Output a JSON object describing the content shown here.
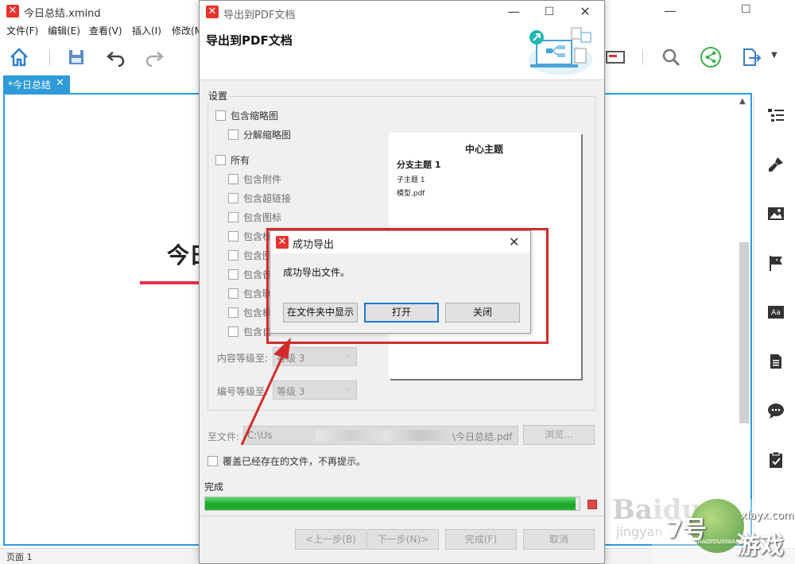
{
  "app": {
    "window_title": "今日总结.xmind",
    "menu": [
      "文件(F)",
      "编辑(E)",
      "查看(V)",
      "插入(I)",
      "修改(M"
    ],
    "doc_tab": "*今日总结",
    "canvas_title_fragment": "今日",
    "status_text": "页面 1"
  },
  "dialog": {
    "window_title": "导出到PDF文档",
    "heading": "导出到PDF文档",
    "settings_group_label": "设置",
    "options": {
      "include_thumbnail": "包含缩略图",
      "split_thumbnail": "分解缩略图",
      "all": "所有",
      "include_attachments": "包含附件",
      "include_hyperlinks": "包含超链接",
      "include_icons": "包含图标",
      "include_labels": "包含标",
      "include_images": "包含图",
      "include_notes": "包含备",
      "include_links": "包含联",
      "include_summary": "包含概",
      "include_custom": "包含自"
    },
    "content_level_label": "内容等级至:",
    "content_level_value": "等级 3",
    "number_level_label": "编号等级至:",
    "number_level_value": "等级 3",
    "preview": {
      "central_topic": "中心主题",
      "branch_topic": "分支主题 1",
      "subtopic": "子主题 1",
      "attachment": "模型.pdf"
    },
    "file_label": "至文件:",
    "file_path_prefix": "C:\\Us",
    "file_path_suffix": "\\今日总结.pdf",
    "browse_button": "浏览...",
    "overwrite_checkbox": "覆盖已经存在的文件，不再提示。",
    "progress_label": "完成",
    "progress_fraction": 0.99,
    "buttons": {
      "back": "<上一步(B)",
      "next": "下一步(N)>",
      "finish": "完成(F)",
      "cancel": "取消"
    }
  },
  "message_box": {
    "title": "成功导出",
    "text": "成功导出文件。",
    "show_in_folder": "在文件夹中显示",
    "open": "打开",
    "close": "关闭"
  },
  "watermarks": {
    "baidu": "Baidu",
    "jingyan": "jingyan",
    "site_number": "7号",
    "site_cn": "游戏",
    "site_url": "xiayx.com",
    "site_pinyin": "QIHAOYOUXIWANG"
  },
  "colors": {
    "accent_blue": "#2f9ad8",
    "xmind_red": "#e8332a",
    "annotation_red": "#d22b2b",
    "progress_green": "#1aa52a"
  },
  "icons": [
    "home-icon",
    "save-icon",
    "undo-icon",
    "redo-icon",
    "search-icon",
    "share-icon",
    "export-icon",
    "outline-icon",
    "format-brush-icon",
    "image-icon",
    "marker-flag-icon",
    "text-style-icon",
    "notes-icon",
    "comment-icon",
    "task-icon"
  ]
}
